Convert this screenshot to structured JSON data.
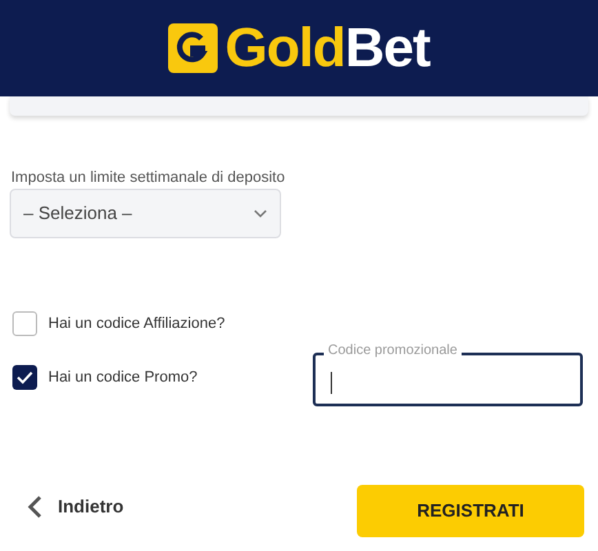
{
  "header": {
    "logo": {
      "parts": [
        "Gold",
        "Bet"
      ]
    }
  },
  "deposit_limit": {
    "label": "Imposta un limite settimanale di deposito",
    "select": {
      "value": "– Seleziona –"
    }
  },
  "options": [
    {
      "label": "Hai un codice Affiliazione?",
      "checked": false
    },
    {
      "label": "Hai un codice Promo?",
      "checked": true
    }
  ],
  "promo_field": {
    "label": "Codice promozionale",
    "focused": true
  },
  "footer": {
    "back": "Indietro",
    "submit": "REGISTRATI"
  }
}
